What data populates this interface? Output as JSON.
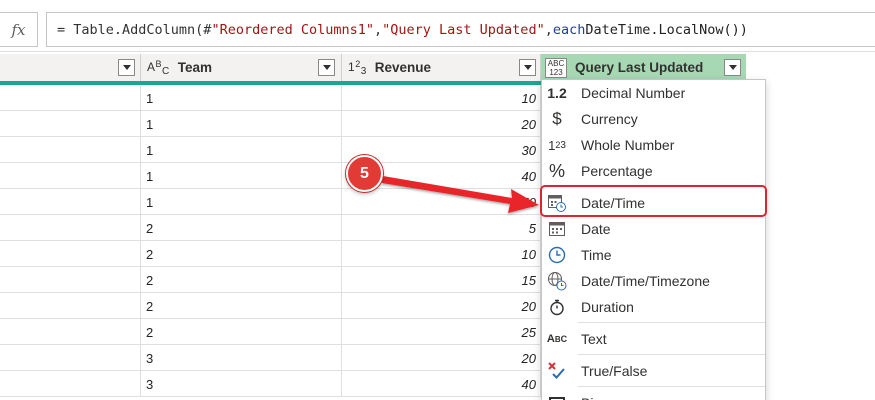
{
  "formula_bar": {
    "fx_label": "fx",
    "prefix": "= Table.AddColumn(#",
    "string1": "\"Reordered Columns1\"",
    "comma1": ", ",
    "string2": "\"Query Last Updated\"",
    "comma2": ", ",
    "keyword": "each",
    "suffix": " DateTime.LocalNow())"
  },
  "columns": [
    {
      "type_icon": "",
      "title": ""
    },
    {
      "type_icon": "ABC",
      "title": "Team"
    },
    {
      "type_icon": "123",
      "title": "Revenue"
    },
    {
      "type_icon": "ABC123",
      "title": "Query Last Updated"
    }
  ],
  "col_icons": {
    "team_a": "A",
    "team_b": "B",
    "team_c": "C",
    "rev_1": "1",
    "rev_2": "2",
    "rev_3": "3",
    "mixed_top": "ABC",
    "mixed_bottom": "123"
  },
  "rows": [
    {
      "team": "1",
      "revenue": "10"
    },
    {
      "team": "1",
      "revenue": "20"
    },
    {
      "team": "1",
      "revenue": "30"
    },
    {
      "team": "1",
      "revenue": "40"
    },
    {
      "team": "1",
      "revenue": "50"
    },
    {
      "team": "2",
      "revenue": "5"
    },
    {
      "team": "2",
      "revenue": "10"
    },
    {
      "team": "2",
      "revenue": "15"
    },
    {
      "team": "2",
      "revenue": "20"
    },
    {
      "team": "2",
      "revenue": "25"
    },
    {
      "team": "3",
      "revenue": "20"
    },
    {
      "team": "3",
      "revenue": "40"
    }
  ],
  "menu": {
    "items": [
      {
        "label": "Decimal Number",
        "icon": "decimal-icon",
        "glyph": "1.2"
      },
      {
        "label": "Currency",
        "icon": "currency-icon",
        "glyph": "$"
      },
      {
        "label": "Whole Number",
        "icon": "whole-number-icon",
        "glyph": "123"
      },
      {
        "label": "Percentage",
        "icon": "percent-icon",
        "glyph": "%"
      },
      {
        "label": "Date/Time",
        "icon": "datetime-icon",
        "glyph": ""
      },
      {
        "label": "Date",
        "icon": "date-icon",
        "glyph": ""
      },
      {
        "label": "Time",
        "icon": "clock-icon",
        "glyph": ""
      },
      {
        "label": "Date/Time/Timezone",
        "icon": "globe-clock-icon",
        "glyph": ""
      },
      {
        "label": "Duration",
        "icon": "stopwatch-icon",
        "glyph": ""
      },
      {
        "label": "Text",
        "icon": "text-icon",
        "glyph": "ABC"
      },
      {
        "label": "True/False",
        "icon": "true-false-icon",
        "glyph": ""
      },
      {
        "label": "Bi",
        "icon": "binary-icon",
        "glyph": ""
      }
    ],
    "highlighted": "Date/Time"
  },
  "annotation": {
    "step_number": "5",
    "color": "#e23b36"
  },
  "colors": {
    "selected_header": "#a7d8b4",
    "teal_underline": "#1ea58f",
    "highlight_border": "#e0242f"
  }
}
